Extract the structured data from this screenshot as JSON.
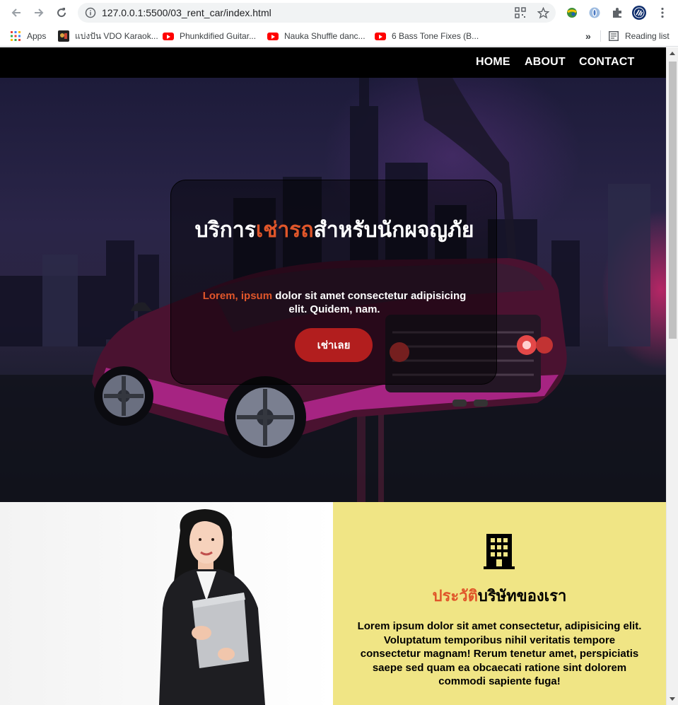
{
  "browser": {
    "url": "127.0.0.1:5500/03_rent_car/index.html",
    "bookmarks": [
      {
        "label": "Apps",
        "icon": "apps-grid-icon"
      },
      {
        "label": "แบ่งปัน VDO Karaok...",
        "icon": "karaoke-icon"
      },
      {
        "label": "Phunkdified Guitar...",
        "icon": "youtube-icon"
      },
      {
        "label": "Nauka Shuffle danc...",
        "icon": "youtube-icon"
      },
      {
        "label": "6 Bass Tone Fixes (B...",
        "icon": "youtube-icon"
      }
    ],
    "more_bookmarks": "»",
    "reading_list": "Reading list"
  },
  "nav": {
    "home": "HOME",
    "about": "ABOUT",
    "contact": "CONTACT"
  },
  "hero": {
    "title_pre": "บริการ",
    "title_accent": "เช่ารถ",
    "title_post": "สำหรับนักผจญภัย",
    "sub_accent": "Lorem, ipsum",
    "sub_rest": " dolor sit amet consectetur adipisicing elit. Quidem, nam.",
    "cta": "เช่าเลย"
  },
  "about": {
    "title_accent": "ประวัติ",
    "title_rest": "บริษัทของเรา",
    "text": "Lorem ipsum dolor sit amet consectetur, adipisicing elit. Voluptatum temporibus nihil veritatis tempore consectetur magnam! Rerum tenetur amet, perspiciatis saepe sed quam ea obcaecati ratione sint dolorem commodi sapiente fuga!"
  },
  "colors": {
    "accent": "#e0562a",
    "cta": "#b21e1e",
    "about_bg": "#f0e585",
    "nav_bg": "#000000"
  }
}
